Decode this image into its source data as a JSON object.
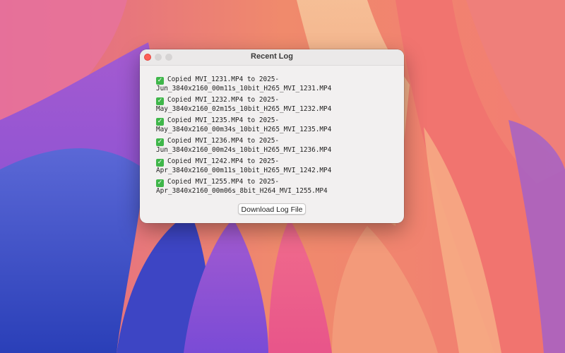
{
  "window": {
    "title": "Recent Log"
  },
  "log": {
    "entries": [
      {
        "icon": "check-mark-icon",
        "line1": "Copied MVI_1231.MP4 to 2025-",
        "line2": "Jun_3840x2160_00m11s_10bit_H265_MVI_1231.MP4"
      },
      {
        "icon": "check-mark-icon",
        "line1": "Copied MVI_1232.MP4 to 2025-",
        "line2": "May_3840x2160_02m15s_10bit_H265_MVI_1232.MP4"
      },
      {
        "icon": "check-mark-icon",
        "line1": "Copied MVI_1235.MP4 to 2025-",
        "line2": "May_3840x2160_00m34s_10bit_H265_MVI_1235.MP4"
      },
      {
        "icon": "check-mark-icon",
        "line1": "Copied MVI_1236.MP4 to 2025-",
        "line2": "Jun_3840x2160_00m24s_10bit_H265_MVI_1236.MP4"
      },
      {
        "icon": "check-mark-icon",
        "line1": "Copied MVI_1242.MP4 to 2025-",
        "line2": "Apr_3840x2160_00m11s_10bit_H265_MVI_1242.MP4"
      },
      {
        "icon": "check-mark-icon",
        "line1": "Copied MVI_1255.MP4 to 2025-",
        "line2": "Apr_3840x2160_00m06s_8bit_H264_MVI_1255.MP4"
      }
    ]
  },
  "actions": {
    "download_label": "Download Log File"
  },
  "colors": {
    "close_button": "#fe5f57",
    "check_mark": "#3fb64a",
    "window_background": "#f2f0f0"
  }
}
